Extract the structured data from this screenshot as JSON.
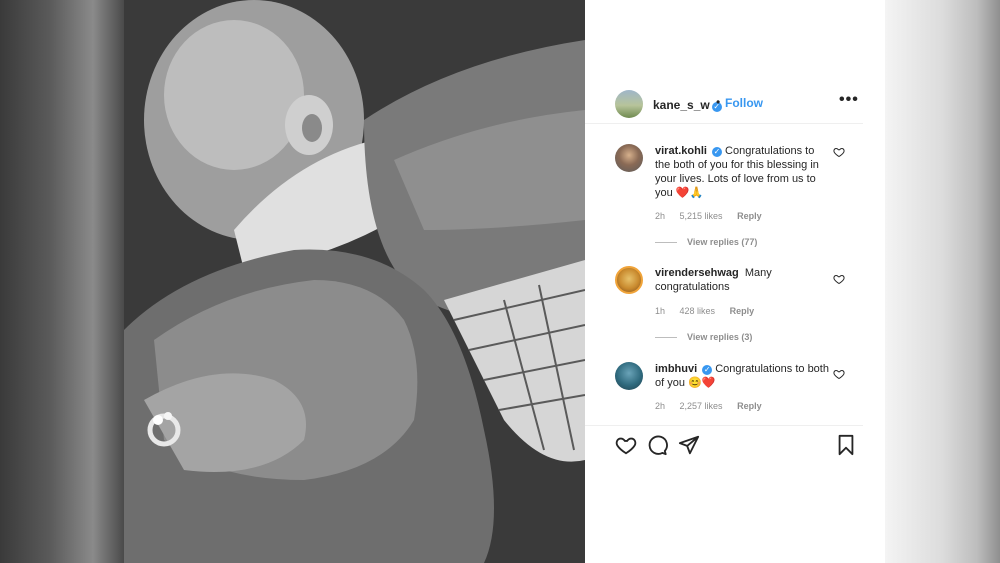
{
  "post": {
    "owner": {
      "username": "kane_s_w",
      "follow_label": "Follow",
      "more_label": "•••",
      "verified_mark": "✓"
    }
  },
  "comments": [
    {
      "username": "virat.kohli",
      "text": "Congratulations to the both of you for this blessing in your lives. Lots of love from us to you",
      "emoji": "❤️🙏",
      "time": "2h",
      "likes": "5,215 likes",
      "reply_label": "Reply",
      "view_replies": "View replies (77)"
    },
    {
      "username": "virendersehwag",
      "text": "Many congratulations",
      "emoji": "",
      "time": "1h",
      "likes": "428 likes",
      "reply_label": "Reply",
      "view_replies": "View replies (3)"
    },
    {
      "username": "imbhuvi",
      "text": "Congratulations to both of you",
      "emoji": "😊❤️",
      "time": "2h",
      "likes": "2,257 likes",
      "reply_label": "Reply"
    }
  ],
  "icons": {
    "like": "heart-icon",
    "comment": "comment-icon",
    "share": "share-icon",
    "save": "bookmark-icon",
    "comment_like": "heart-icon",
    "more": "more-icon"
  },
  "colors": {
    "accent": "#3897f0",
    "text": "#262626",
    "muted": "#8e8e8e",
    "heart": "#e0245e"
  }
}
